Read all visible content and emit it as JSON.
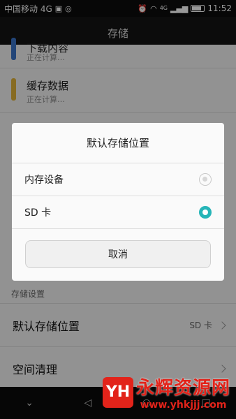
{
  "status_bar": {
    "carrier": "中国移动 4G",
    "time": "11:52",
    "signal_label": "4G"
  },
  "title": "存储",
  "apps": [
    {
      "title": "下载内容",
      "subtitle": "正在计算…",
      "color": "#3a74c9"
    },
    {
      "title": "缓存数据",
      "subtitle": "正在计算…",
      "color": "#e2b33a"
    }
  ],
  "section_storage_settings": "存储设置",
  "settings": {
    "default_location_label": "默认存储位置",
    "default_location_value": "SD 卡",
    "space_cleanup_label": "空间清理"
  },
  "dialog": {
    "title": "默认存储位置",
    "options": [
      {
        "label": "内存设备",
        "selected": false
      },
      {
        "label": "SD 卡",
        "selected": true
      }
    ],
    "cancel_label": "取消",
    "accent": "#26b5b8"
  },
  "watermark": {
    "title": "永辉资源网",
    "url": "www.yhkjjj.com"
  }
}
